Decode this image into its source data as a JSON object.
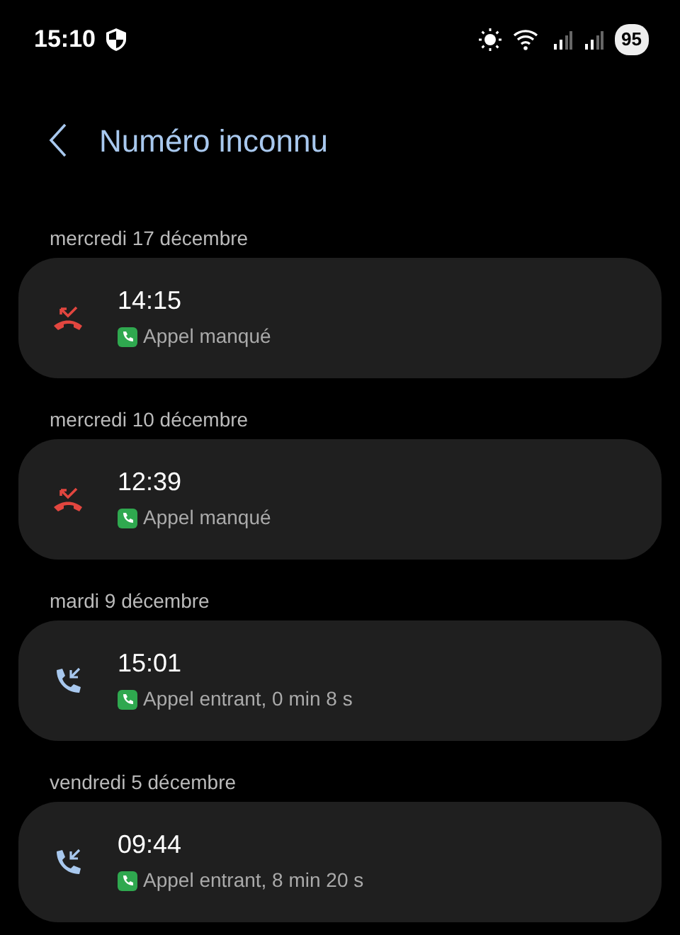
{
  "status_bar": {
    "time": "15:10",
    "battery": "95"
  },
  "header": {
    "title": "Numéro inconnu"
  },
  "calls": [
    {
      "date": "mercredi 17 décembre",
      "time": "14:15",
      "kind": "missed",
      "detail": "Appel manqué"
    },
    {
      "date": "mercredi 10 décembre",
      "time": "12:39",
      "kind": "missed",
      "detail": "Appel manqué"
    },
    {
      "date": "mardi 9 décembre",
      "time": "15:01",
      "kind": "incoming",
      "detail": "Appel entrant, 0 min 8 s"
    },
    {
      "date": "vendredi 5 décembre",
      "time": "09:44",
      "kind": "incoming",
      "detail": "Appel entrant, 8 min 20 s"
    }
  ]
}
